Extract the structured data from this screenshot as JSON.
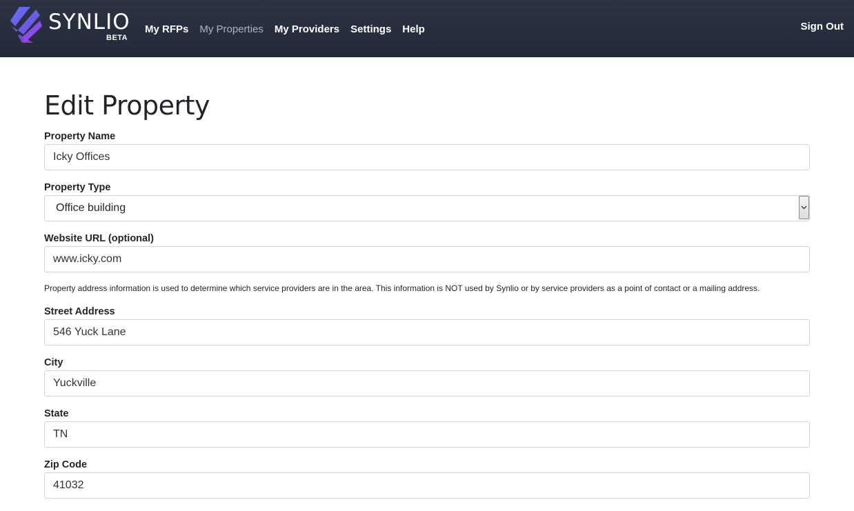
{
  "brand": {
    "name": "SYNLIO",
    "badge": "BETA",
    "colors": {
      "logo_top": "#5b6cf0",
      "logo_bottom": "#a23ee6"
    }
  },
  "nav": {
    "items": [
      {
        "label": "My RFPs",
        "active": false
      },
      {
        "label": "My Properties",
        "active": true
      },
      {
        "label": "My Providers",
        "active": false
      },
      {
        "label": "Settings",
        "active": false
      },
      {
        "label": "Help",
        "active": false
      }
    ],
    "sign_out": "Sign Out"
  },
  "page": {
    "title": "Edit Property"
  },
  "form": {
    "property_name": {
      "label": "Property Name",
      "value": "Icky Offices"
    },
    "property_type": {
      "label": "Property Type",
      "value": "Office building"
    },
    "website_url": {
      "label": "Website URL (optional)",
      "value": "www.icky.com"
    },
    "address_help": "Property address information is used to determine which service providers are in the area. This information is NOT used by Synlio or by service providers as a point of contact or a mailing address.",
    "street_address": {
      "label": "Street Address",
      "value": "546 Yuck Lane"
    },
    "city": {
      "label": "City",
      "value": "Yuckville"
    },
    "state": {
      "label": "State",
      "value": "TN"
    },
    "zip_code": {
      "label": "Zip Code",
      "value": "41032"
    }
  }
}
